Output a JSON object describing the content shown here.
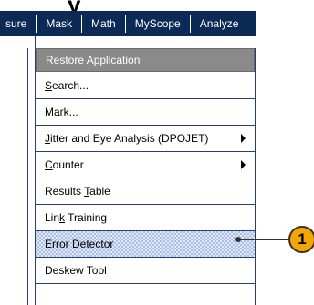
{
  "page_title": "y",
  "menubar": {
    "items": [
      "sure",
      "Mask",
      "Math",
      "MyScope",
      "Analyze"
    ]
  },
  "dropdown": {
    "items": [
      {
        "pre": "Restore Application",
        "u": "",
        "post": ""
      },
      {
        "pre": "",
        "u": "S",
        "post": "earch..."
      },
      {
        "pre": "",
        "u": "M",
        "post": "ark..."
      },
      {
        "pre": "",
        "u": "J",
        "post": "itter and Eye Analysis (DPOJET)"
      },
      {
        "pre": "",
        "u": "C",
        "post": "ounter"
      },
      {
        "pre": "Results ",
        "u": "T",
        "post": "able"
      },
      {
        "pre": "Lin",
        "u": "k",
        "post": " Training"
      },
      {
        "pre": "Error ",
        "u": "D",
        "post": "etector"
      },
      {
        "pre": "Deskew Tool",
        "u": "",
        "post": ""
      }
    ]
  },
  "callout": {
    "number": "1"
  },
  "colors": {
    "menubar_bg": "#0b2a55",
    "highlight": "#a9bfe6",
    "callout_fill": "#f2a800"
  }
}
